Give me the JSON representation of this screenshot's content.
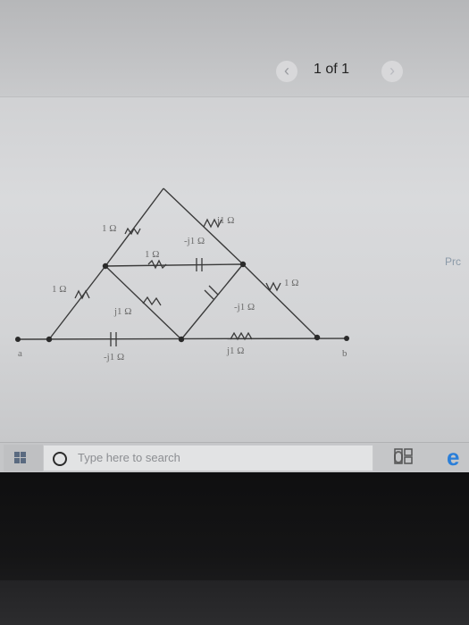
{
  "viewer": {
    "pager_text": "1 of 1",
    "prev_glyph": "‹",
    "next_glyph": "›",
    "side_text": "Prc"
  },
  "circuit": {
    "labels": {
      "r_left_top": "1 Ω",
      "l_right_top": "j1 Ω",
      "r_center": "1 Ω",
      "c_center_top": "-j1 Ω",
      "r_left": "1 Ω",
      "l_left_mid": "j1 Ω",
      "c_center_mid": "-j1 Ω",
      "r_right": "1 Ω",
      "l_bottom": "j1 Ω",
      "c_bottom": "-j1 Ω",
      "terminal_a": "a",
      "terminal_b": "b"
    }
  },
  "taskbar": {
    "search_placeholder": "Type here to search",
    "icons": [
      "windows-start-icon",
      "search-circle-icon",
      "microphone-icon",
      "task-view-icon",
      "edge-browser-icon"
    ]
  },
  "colors": {
    "screen_bg": "#d6d7d9",
    "wire": "#3a3a3a",
    "label": "#6c6c6c",
    "taskbar": "#c5c6c8",
    "edge_accent": "#2b7fd9",
    "side_text": "#8b9aa8"
  }
}
